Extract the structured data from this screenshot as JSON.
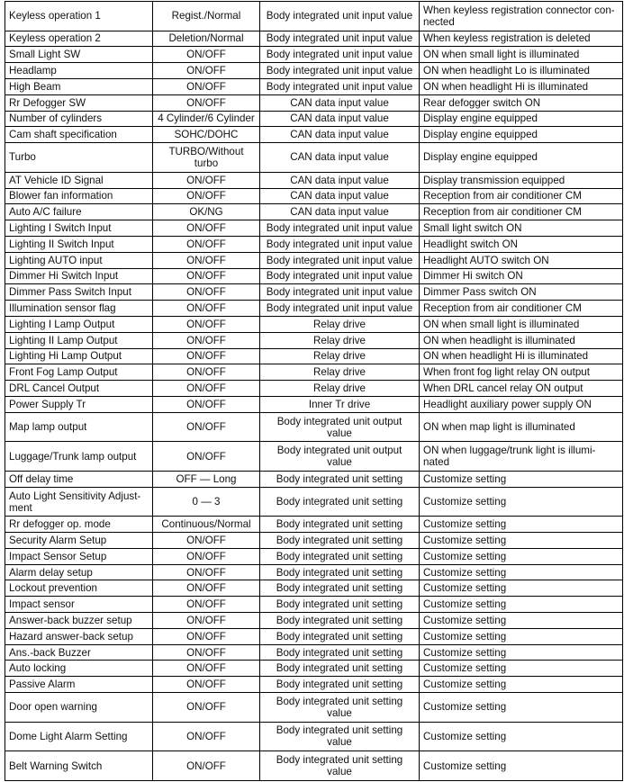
{
  "rows": [
    [
      "Keyless operation 1",
      "Regist./Normal",
      "Body integrated unit input value",
      "When keyless registration connector con-nected"
    ],
    [
      "Keyless operation 2",
      "Deletion/Normal",
      "Body integrated unit input value",
      "When keyless registration is deleted"
    ],
    [
      "Small Light SW",
      "ON/OFF",
      "Body integrated unit input value",
      "ON when small light is illuminated"
    ],
    [
      "Headlamp",
      "ON/OFF",
      "Body integrated unit input value",
      "ON when headlight Lo is illuminated"
    ],
    [
      "High Beam",
      "ON/OFF",
      "Body integrated unit input value",
      "ON when headlight Hi is illuminated"
    ],
    [
      "Rr Defogger SW",
      "ON/OFF",
      "CAN data input value",
      "Rear defogger switch ON"
    ],
    [
      "Number of cylinders",
      "4 Cylinder/6 Cylinder",
      "CAN data input value",
      "Display engine equipped"
    ],
    [
      "Cam shaft specification",
      "SOHC/DOHC",
      "CAN data input value",
      "Display engine equipped"
    ],
    [
      "Turbo",
      "TURBO/Without turbo",
      "CAN data input value",
      "Display engine equipped"
    ],
    [
      "AT Vehicle ID Signal",
      "ON/OFF",
      "CAN data input value",
      "Display transmission equipped"
    ],
    [
      "Blower fan information",
      "ON/OFF",
      "CAN data input value",
      "Reception from air conditioner CM"
    ],
    [
      "Auto A/C failure",
      "OK/NG",
      "CAN data input value",
      "Reception from air conditioner CM"
    ],
    [
      "Lighting I Switch Input",
      "ON/OFF",
      "Body integrated unit input value",
      "Small light switch ON"
    ],
    [
      "Lighting II Switch Input",
      "ON/OFF",
      "Body integrated unit input value",
      "Headlight switch ON"
    ],
    [
      "Lighting AUTO input",
      "ON/OFF",
      "Body integrated unit input value",
      "Headlight AUTO switch ON"
    ],
    [
      "Dimmer Hi Switch Input",
      "ON/OFF",
      "Body integrated unit input value",
      "Dimmer Hi switch ON"
    ],
    [
      "Dimmer Pass Switch Input",
      "ON/OFF",
      "Body integrated unit input value",
      "Dimmer Pass switch ON"
    ],
    [
      "Illumination sensor flag",
      "ON/OFF",
      "Body integrated unit input value",
      "Reception from air conditioner CM"
    ],
    [
      "Lighting I Lamp Output",
      "ON/OFF",
      "Relay drive",
      "ON when small light is illuminated"
    ],
    [
      "Lighting II Lamp Output",
      "ON/OFF",
      "Relay drive",
      "ON when headlight is illuminated"
    ],
    [
      "Lighting Hi Lamp Output",
      "ON/OFF",
      "Relay drive",
      "ON when headlight Hi is illuminated"
    ],
    [
      "Front Fog Lamp Output",
      "ON/OFF",
      "Relay drive",
      "When front fog light relay ON output"
    ],
    [
      "DRL Cancel Output",
      "ON/OFF",
      "Relay drive",
      "When DRL cancel relay ON output"
    ],
    [
      "Power Supply Tr",
      "ON/OFF",
      "Inner Tr drive",
      "Headlight auxiliary power supply ON"
    ],
    [
      "Map lamp output",
      "ON/OFF",
      "Body integrated unit output value",
      "ON when map light is illuminated"
    ],
    [
      "Luggage/Trunk lamp output",
      "ON/OFF",
      "Body integrated unit output value",
      "ON when luggage/trunk light is illumi-nated"
    ],
    [
      "Off delay time",
      "OFF — Long",
      "Body integrated unit setting",
      "Customize setting"
    ],
    [
      "Auto Light Sensitivity Adjust-ment",
      "0 — 3",
      "Body integrated unit setting",
      "Customize setting"
    ],
    [
      "Rr defogger op. mode",
      "Continuous/Normal",
      "Body integrated unit setting",
      "Customize setting"
    ],
    [
      "Security Alarm Setup",
      "ON/OFF",
      "Body integrated unit setting",
      "Customize setting"
    ],
    [
      "Impact Sensor Setup",
      "ON/OFF",
      "Body integrated unit setting",
      "Customize setting"
    ],
    [
      "Alarm delay setup",
      "ON/OFF",
      "Body integrated unit setting",
      "Customize setting"
    ],
    [
      "Lockout prevention",
      "ON/OFF",
      "Body integrated unit setting",
      "Customize setting"
    ],
    [
      "Impact sensor",
      "ON/OFF",
      "Body integrated unit setting",
      "Customize setting"
    ],
    [
      "Answer-back buzzer setup",
      "ON/OFF",
      "Body integrated unit setting",
      "Customize setting"
    ],
    [
      "Hazard answer-back setup",
      "ON/OFF",
      "Body integrated unit setting",
      "Customize setting"
    ],
    [
      "Ans.-back Buzzer",
      "ON/OFF",
      "Body integrated unit setting",
      "Customize setting"
    ],
    [
      "Auto locking",
      "ON/OFF",
      "Body integrated unit setting",
      "Customize setting"
    ],
    [
      "Passive Alarm",
      "ON/OFF",
      "Body integrated unit setting",
      "Customize setting"
    ],
    [
      "Door open warning",
      "ON/OFF",
      "Body integrated unit setting value",
      "Customize setting"
    ],
    [
      "Dome Light Alarm Setting",
      "ON/OFF",
      "Body integrated unit setting value",
      "Customize setting"
    ],
    [
      "Belt Warning Switch",
      "ON/OFF",
      "Body integrated unit setting value",
      "Customize setting"
    ]
  ]
}
